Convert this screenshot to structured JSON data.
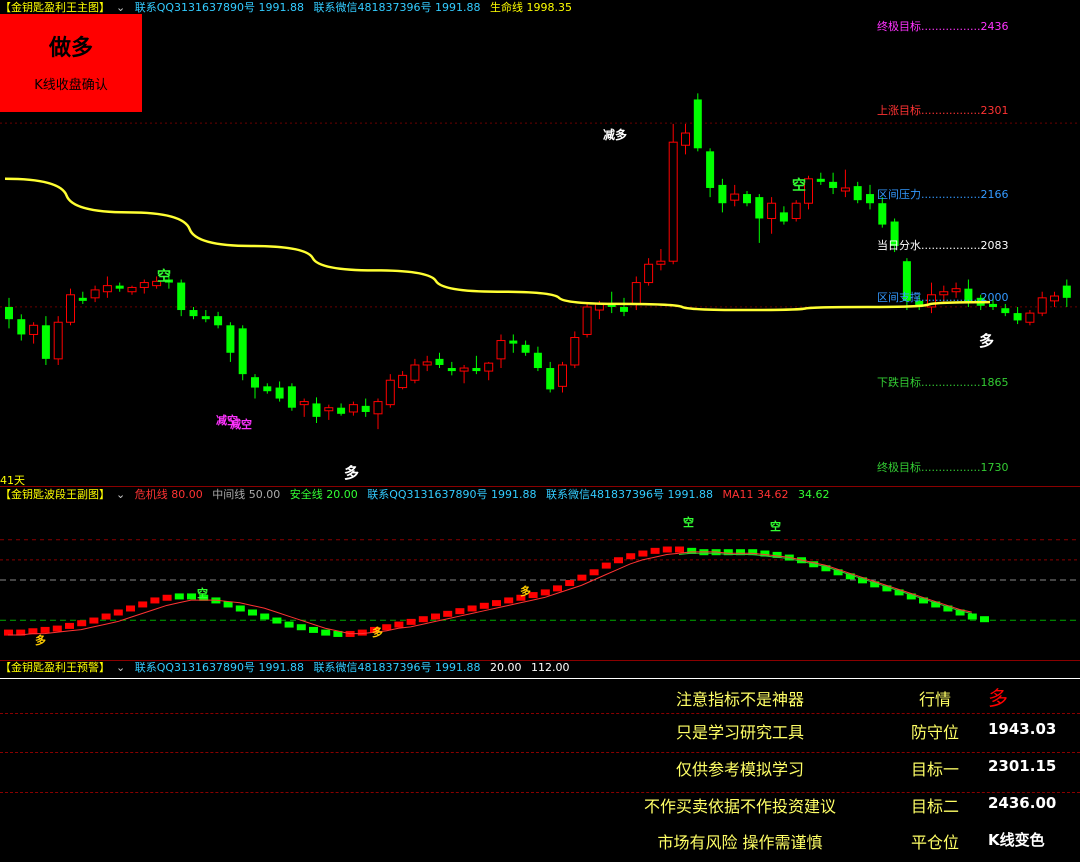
{
  "main_header": {
    "title": "【金钥匙盈利王主图】",
    "contact_qq": "联系QQ3131637890号 1991.88",
    "contact_wx": "联系微信481837396号 1991.88",
    "life_line": "生命线 1998.35"
  },
  "badge": {
    "label": "做多",
    "note": "K线收盘确认"
  },
  "period_label": "41天",
  "targets": [
    {
      "label": "终极目标",
      "value": "2436",
      "color": "#ff33ff"
    },
    {
      "label": "上涨目标",
      "value": "2301",
      "color": "#ff3333"
    },
    {
      "label": "区间压力",
      "value": "2166",
      "color": "#3399ff"
    },
    {
      "label": "当日分水",
      "value": "2083",
      "color": "#ffffff"
    },
    {
      "label": "区间支撑",
      "value": "2000",
      "color": "#3399ff"
    },
    {
      "label": "下跌目标",
      "value": "1865",
      "color": "#33cc33"
    },
    {
      "label": "终极目标",
      "value": "1730",
      "color": "#33cc33"
    }
  ],
  "signals": [
    {
      "text": "空",
      "color": "#33ff33"
    },
    {
      "text": "减空",
      "color": "#ff33ff"
    },
    {
      "text": "减空",
      "color": "#ff33ff"
    },
    {
      "text": "多",
      "color": "#ffffff"
    },
    {
      "text": "减多",
      "color": "#ffffff"
    },
    {
      "text": "空",
      "color": "#33ff33"
    },
    {
      "text": "多",
      "color": "#ffffff"
    }
  ],
  "sub_header": {
    "title": "【金钥匙波段王副图】",
    "danger": "危机线 80.00",
    "middle": "中间线 50.00",
    "safe": "安全线 20.00",
    "contact_qq": "联系QQ3131637890号 1991.88",
    "contact_wx": "联系微信481837396号 1991.88",
    "ma": "MA11 34.62",
    "ma_val": "34.62"
  },
  "sub_signals": [
    {
      "text": "多",
      "color": "#ffcc00"
    },
    {
      "text": "空",
      "color": "#33ff33"
    },
    {
      "text": "多",
      "color": "#ffcc00"
    },
    {
      "text": "多",
      "color": "#ffcc00"
    },
    {
      "text": "空",
      "color": "#33ff33"
    },
    {
      "text": "空",
      "color": "#33ff33"
    }
  ],
  "alert_header": {
    "title": "【金钥匙盈利王预警】",
    "contact_qq": "联系QQ3131637890号 1991.88",
    "contact_wx": "联系微信481837396号 1991.88",
    "v1": "20.00",
    "v2": "112.00"
  },
  "alert_rows": [
    {
      "left": "注意指标不是神器",
      "mid": "行情",
      "right": "多"
    },
    {
      "left": "只是学习研究工具",
      "mid": "防守位",
      "right": "1943.03"
    },
    {
      "left": "仅供参考模拟学习",
      "mid": "目标一",
      "right": "2301.15"
    },
    {
      "left": "不作买卖依据不作投资建议",
      "mid": "目标二",
      "right": "2436.00"
    },
    {
      "left": "市场有风险 操作需谨慎",
      "mid": "平仓位",
      "right": "K线变色"
    }
  ],
  "chart_data": {
    "type": "candlestick",
    "colors": {
      "up": "#ff0000",
      "down": "#00ff00",
      "life_line": "#ffff33"
    },
    "y_range": [
      1700,
      2470
    ],
    "candles": [
      {
        "o": 1990,
        "h": 2005,
        "l": 1955,
        "c": 1970
      },
      {
        "o": 1970,
        "h": 1978,
        "l": 1935,
        "c": 1945
      },
      {
        "o": 1945,
        "h": 1965,
        "l": 1930,
        "c": 1960
      },
      {
        "o": 1960,
        "h": 1975,
        "l": 1895,
        "c": 1905
      },
      {
        "o": 1905,
        "h": 1975,
        "l": 1895,
        "c": 1965
      },
      {
        "o": 1965,
        "h": 2020,
        "l": 1960,
        "c": 2010
      },
      {
        "o": 2005,
        "h": 2015,
        "l": 1995,
        "c": 2000
      },
      {
        "o": 2005,
        "h": 2025,
        "l": 1998,
        "c": 2018
      },
      {
        "o": 2015,
        "h": 2040,
        "l": 2005,
        "c": 2025
      },
      {
        "o": 2025,
        "h": 2030,
        "l": 2015,
        "c": 2020
      },
      {
        "o": 2015,
        "h": 2025,
        "l": 2010,
        "c": 2022
      },
      {
        "o": 2022,
        "h": 2035,
        "l": 2012,
        "c": 2030
      },
      {
        "o": 2025,
        "h": 2040,
        "l": 2020,
        "c": 2032
      },
      {
        "o": 2035,
        "h": 2050,
        "l": 2020,
        "c": 2030
      },
      {
        "o": 2030,
        "h": 2035,
        "l": 1975,
        "c": 1985
      },
      {
        "o": 1985,
        "h": 1990,
        "l": 1970,
        "c": 1975
      },
      {
        "o": 1975,
        "h": 1985,
        "l": 1965,
        "c": 1970
      },
      {
        "o": 1975,
        "h": 1982,
        "l": 1955,
        "c": 1960
      },
      {
        "o": 1960,
        "h": 1965,
        "l": 1900,
        "c": 1915
      },
      {
        "o": 1955,
        "h": 1960,
        "l": 1870,
        "c": 1880
      },
      {
        "o": 1875,
        "h": 1880,
        "l": 1840,
        "c": 1858
      },
      {
        "o": 1860,
        "h": 1865,
        "l": 1848,
        "c": 1852
      },
      {
        "o": 1858,
        "h": 1868,
        "l": 1835,
        "c": 1840
      },
      {
        "o": 1860,
        "h": 1865,
        "l": 1820,
        "c": 1825
      },
      {
        "o": 1830,
        "h": 1840,
        "l": 1810,
        "c": 1835
      },
      {
        "o": 1832,
        "h": 1842,
        "l": 1800,
        "c": 1810
      },
      {
        "o": 1820,
        "h": 1830,
        "l": 1805,
        "c": 1825
      },
      {
        "o": 1825,
        "h": 1832,
        "l": 1812,
        "c": 1815
      },
      {
        "o": 1818,
        "h": 1835,
        "l": 1812,
        "c": 1830
      },
      {
        "o": 1828,
        "h": 1840,
        "l": 1810,
        "c": 1818
      },
      {
        "o": 1815,
        "h": 1840,
        "l": 1790,
        "c": 1835
      },
      {
        "o": 1830,
        "h": 1880,
        "l": 1825,
        "c": 1870
      },
      {
        "o": 1858,
        "h": 1885,
        "l": 1855,
        "c": 1878
      },
      {
        "o": 1870,
        "h": 1905,
        "l": 1865,
        "c": 1895
      },
      {
        "o": 1895,
        "h": 1910,
        "l": 1885,
        "c": 1900
      },
      {
        "o": 1905,
        "h": 1915,
        "l": 1890,
        "c": 1895
      },
      {
        "o": 1890,
        "h": 1900,
        "l": 1878,
        "c": 1885
      },
      {
        "o": 1885,
        "h": 1895,
        "l": 1865,
        "c": 1890
      },
      {
        "o": 1890,
        "h": 1910,
        "l": 1880,
        "c": 1885
      },
      {
        "o": 1885,
        "h": 1900,
        "l": 1870,
        "c": 1898
      },
      {
        "o": 1905,
        "h": 1945,
        "l": 1890,
        "c": 1935
      },
      {
        "o": 1935,
        "h": 1945,
        "l": 1915,
        "c": 1930
      },
      {
        "o": 1928,
        "h": 1935,
        "l": 1910,
        "c": 1915
      },
      {
        "o": 1915,
        "h": 1925,
        "l": 1885,
        "c": 1890
      },
      {
        "o": 1890,
        "h": 1900,
        "l": 1850,
        "c": 1855
      },
      {
        "o": 1860,
        "h": 1900,
        "l": 1850,
        "c": 1895
      },
      {
        "o": 1895,
        "h": 1950,
        "l": 1890,
        "c": 1940
      },
      {
        "o": 1945,
        "h": 1995,
        "l": 1940,
        "c": 1990
      },
      {
        "o": 1985,
        "h": 2000,
        "l": 1970,
        "c": 1995
      },
      {
        "o": 1995,
        "h": 2015,
        "l": 1980,
        "c": 1990
      },
      {
        "o": 1990,
        "h": 2005,
        "l": 1975,
        "c": 1982
      },
      {
        "o": 1995,
        "h": 2040,
        "l": 1985,
        "c": 2030
      },
      {
        "o": 2030,
        "h": 2070,
        "l": 2025,
        "c": 2060
      },
      {
        "o": 2060,
        "h": 2085,
        "l": 2050,
        "c": 2065
      },
      {
        "o": 2065,
        "h": 2290,
        "l": 2060,
        "c": 2260
      },
      {
        "o": 2255,
        "h": 2290,
        "l": 2240,
        "c": 2275
      },
      {
        "o": 2330,
        "h": 2340,
        "l": 2245,
        "c": 2250
      },
      {
        "o": 2245,
        "h": 2250,
        "l": 2170,
        "c": 2185
      },
      {
        "o": 2190,
        "h": 2200,
        "l": 2145,
        "c": 2160
      },
      {
        "o": 2165,
        "h": 2190,
        "l": 2155,
        "c": 2175
      },
      {
        "o": 2175,
        "h": 2180,
        "l": 2155,
        "c": 2160
      },
      {
        "o": 2170,
        "h": 2175,
        "l": 2095,
        "c": 2135
      },
      {
        "o": 2135,
        "h": 2170,
        "l": 2110,
        "c": 2160
      },
      {
        "o": 2145,
        "h": 2155,
        "l": 2125,
        "c": 2130
      },
      {
        "o": 2135,
        "h": 2165,
        "l": 2130,
        "c": 2160
      },
      {
        "o": 2160,
        "h": 2205,
        "l": 2150,
        "c": 2200
      },
      {
        "o": 2200,
        "h": 2210,
        "l": 2190,
        "c": 2195
      },
      {
        "o": 2195,
        "h": 2210,
        "l": 2175,
        "c": 2185
      },
      {
        "o": 2180,
        "h": 2215,
        "l": 2170,
        "c": 2185
      },
      {
        "o": 2188,
        "h": 2195,
        "l": 2160,
        "c": 2165
      },
      {
        "o": 2175,
        "h": 2190,
        "l": 2150,
        "c": 2160
      },
      {
        "o": 2160,
        "h": 2170,
        "l": 2120,
        "c": 2125
      },
      {
        "o": 2130,
        "h": 2135,
        "l": 2080,
        "c": 2090
      },
      {
        "o": 2065,
        "h": 2070,
        "l": 1985,
        "c": 2000
      },
      {
        "o": 2000,
        "h": 2010,
        "l": 1985,
        "c": 1990
      },
      {
        "o": 1990,
        "h": 2030,
        "l": 1980,
        "c": 2010
      },
      {
        "o": 2010,
        "h": 2025,
        "l": 1995,
        "c": 2015
      },
      {
        "o": 2015,
        "h": 2030,
        "l": 2005,
        "c": 2020
      },
      {
        "o": 2020,
        "h": 2035,
        "l": 1990,
        "c": 1998
      },
      {
        "o": 2005,
        "h": 2010,
        "l": 1985,
        "c": 1992
      },
      {
        "o": 1995,
        "h": 2005,
        "l": 1985,
        "c": 1990
      },
      {
        "o": 1988,
        "h": 1995,
        "l": 1975,
        "c": 1980
      },
      {
        "o": 1980,
        "h": 1990,
        "l": 1962,
        "c": 1968
      },
      {
        "o": 1965,
        "h": 1985,
        "l": 1960,
        "c": 1980
      },
      {
        "o": 1980,
        "h": 2015,
        "l": 1975,
        "c": 2005
      },
      {
        "o": 2000,
        "h": 2015,
        "l": 1990,
        "c": 2008
      },
      {
        "o": 2025,
        "h": 2035,
        "l": 1990,
        "c": 2005
      }
    ],
    "life_line": [
      2200,
      2145,
      2090,
      2050,
      2015,
      1995,
      1985,
      1990,
      1998
    ],
    "sub": {
      "y_range": [
        0,
        100
      ],
      "levels": {
        "danger": 80,
        "middle": 50,
        "safe": 20
      },
      "bars": [
        10,
        10,
        11,
        12,
        13,
        15,
        17,
        19,
        22,
        25,
        28,
        31,
        34,
        36,
        37,
        37,
        36,
        34,
        31,
        28,
        25,
        22,
        19,
        16,
        14,
        12,
        10,
        9,
        9,
        10,
        12,
        14,
        16,
        18,
        20,
        22,
        24,
        26,
        28,
        30,
        32,
        34,
        36,
        38,
        40,
        43,
        47,
        51,
        55,
        60,
        64,
        67,
        69,
        71,
        72,
        72,
        71,
        70,
        70,
        70,
        70,
        70,
        69,
        68,
        66,
        64,
        61,
        58,
        55,
        52,
        49,
        46,
        43,
        40,
        37,
        34,
        31,
        28,
        25,
        22,
        20
      ],
      "ma": [
        9,
        9,
        10,
        10,
        11,
        12,
        13,
        15,
        17,
        19,
        22,
        25,
        28,
        31,
        33,
        35,
        35,
        35,
        34,
        33,
        31,
        29,
        26,
        23,
        20,
        17,
        14,
        12,
        10,
        10,
        11,
        12,
        14,
        15,
        17,
        19,
        21,
        23,
        25,
        27,
        29,
        31,
        33,
        35,
        37,
        40,
        43,
        46,
        50,
        54,
        58,
        62,
        65,
        67,
        69,
        70,
        71,
        71,
        71,
        70,
        70,
        70,
        69,
        68,
        67,
        65,
        63,
        61,
        58,
        55,
        52,
        49,
        46,
        43,
        40,
        37,
        34,
        31,
        28,
        26
      ],
      "ma_value": 34.62
    }
  }
}
